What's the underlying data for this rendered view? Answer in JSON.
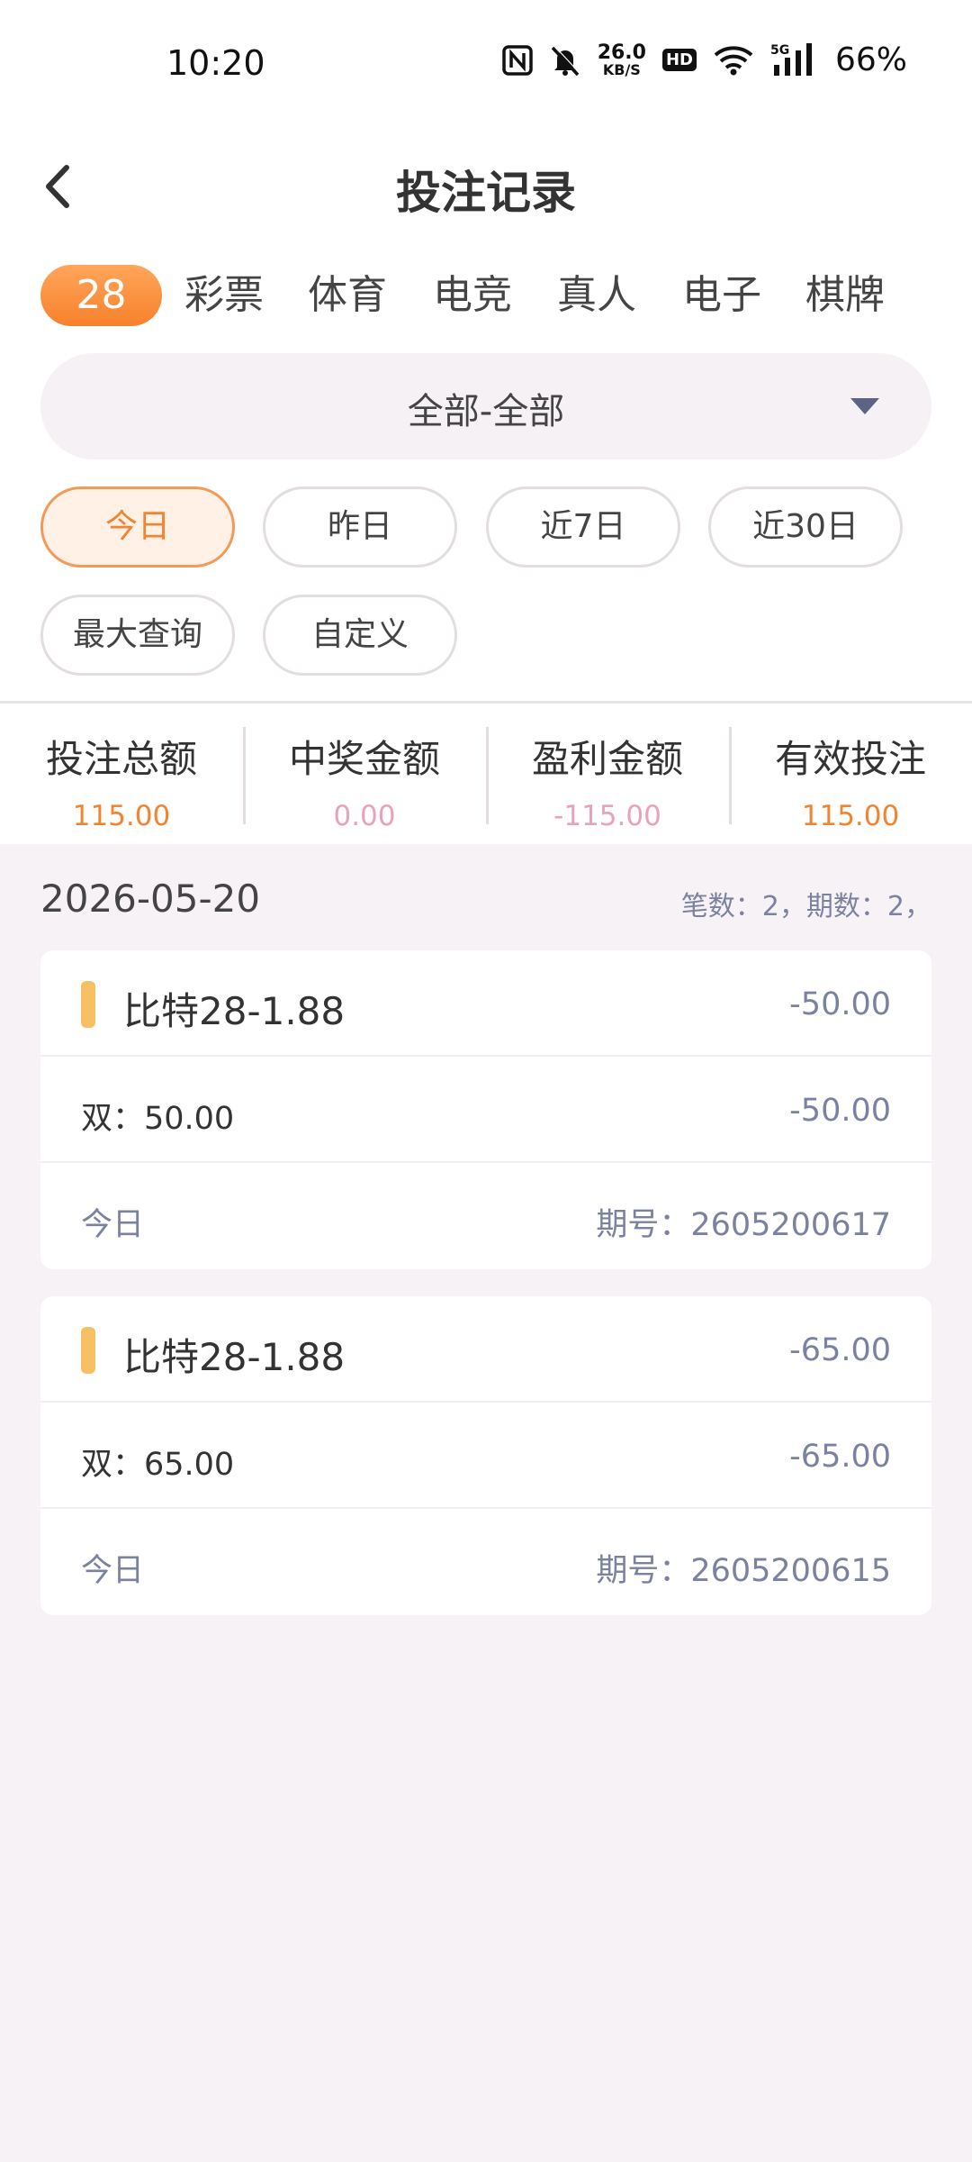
{
  "status_bar": {
    "time": "10:20",
    "net_speed_value": "26.0",
    "net_speed_unit": "KB/S",
    "hd": "HD",
    "network_type": "5G",
    "battery": "66%"
  },
  "header": {
    "title": "投注记录"
  },
  "categories": {
    "active": "28",
    "items": [
      "彩票",
      "体育",
      "电竞",
      "真人",
      "电子",
      "棋牌"
    ]
  },
  "filter": {
    "selected": "全部-全部"
  },
  "date_filters": [
    "今日",
    "昨日",
    "近7日",
    "近30日",
    "最大查询",
    "自定义"
  ],
  "summary": [
    {
      "label": "投注总额",
      "value": "115.00",
      "color": "#f2832f"
    },
    {
      "label": "中奖金额",
      "value": "0.00",
      "color": "#eaa1bd"
    },
    {
      "label": "盈利金额",
      "value": "-115.00",
      "color": "#eaa1bd"
    },
    {
      "label": "有效投注",
      "value": "115.00",
      "color": "#f2832f"
    }
  ],
  "records": {
    "date": "2026-05-20",
    "meta": "笔数：2，期数：2，",
    "items": [
      {
        "game": "比特28-1.88",
        "amount": "-50.00",
        "bet": "双：50.00",
        "bet_result": "-50.00",
        "day": "今日",
        "issue": "期号：2605200617"
      },
      {
        "game": "比特28-1.88",
        "amount": "-65.00",
        "bet": "双：65.00",
        "bet_result": "-65.00",
        "day": "今日",
        "issue": "期号：2605200615"
      }
    ]
  },
  "colors": {
    "accent_orange": "#f8812c",
    "record_bar": "#f8c064",
    "page_bg": "#f7f2f6"
  }
}
